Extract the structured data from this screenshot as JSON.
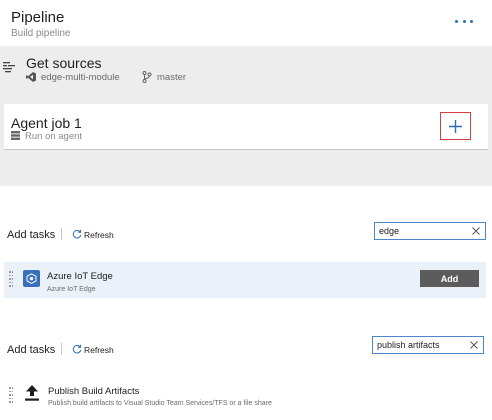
{
  "header": {
    "title": "Pipeline",
    "subtitle": "Build pipeline",
    "more_icon": "ellipsis-icon"
  },
  "get_sources": {
    "title": "Get sources",
    "repository": "edge-multi-module",
    "branch": "master",
    "icons": [
      "list-icon",
      "visual-studio-icon",
      "branch-icon"
    ]
  },
  "agent_job": {
    "title": "Agent job 1",
    "subtitle": "Run on agent",
    "add_icon": "plus-icon",
    "highlight_color": "#d43f3f"
  },
  "task_search_1": {
    "label": "Add tasks",
    "refresh_label": "Refresh",
    "search_value": "edge",
    "results": [
      {
        "name": "Azure IoT Edge",
        "description": "Azure IoT Edge",
        "icon": "azure-iot-edge-icon",
        "action_label": "Add"
      }
    ]
  },
  "task_search_2": {
    "label": "Add tasks",
    "refresh_label": "Refresh",
    "search_value": "publish artifacts",
    "results": [
      {
        "name": "Publish Build Artifacts",
        "description": "Publish build artifacts to Visual Studio Team Services/TFS or a file share",
        "icon": "upload-icon"
      }
    ]
  },
  "colors": {
    "accent": "#2d6fb5",
    "panel_gray": "#ededed",
    "selected_row": "#ebf1f8",
    "add_button": "#5c5c5c"
  }
}
